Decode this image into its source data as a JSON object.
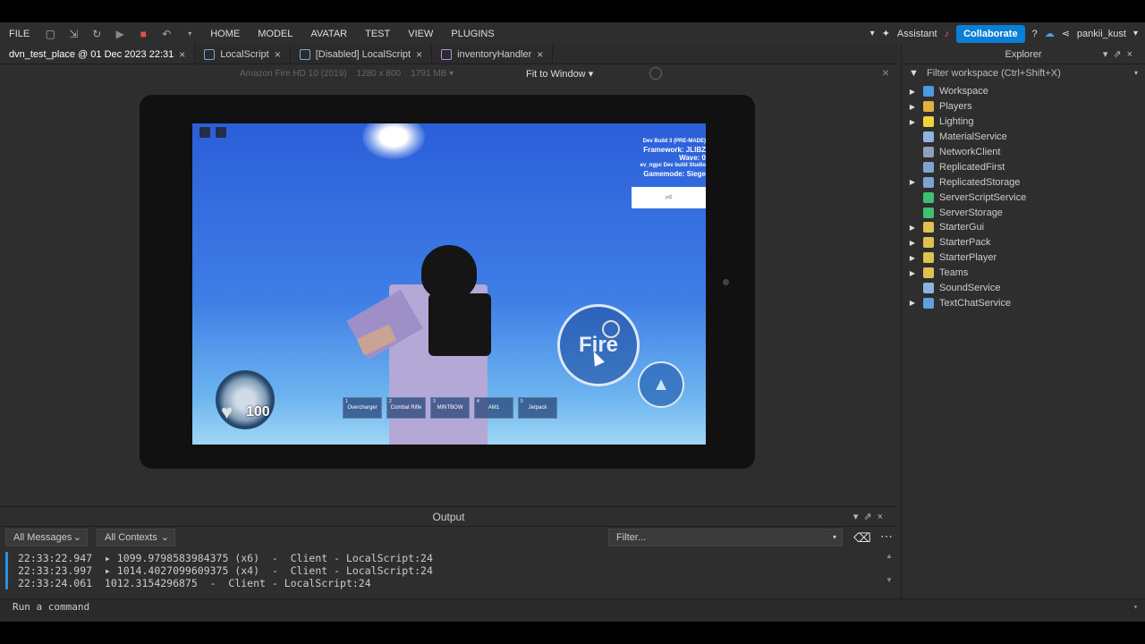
{
  "menu": {
    "items": [
      "FILE",
      "HOME",
      "MODEL",
      "AVATAR",
      "TEST",
      "VIEW",
      "PLUGINS"
    ],
    "assistant": "Assistant",
    "collaborate": "Collaborate",
    "username": "pankii_kust"
  },
  "tabs": [
    {
      "label": "dvn_test_place @ 01 Dec 2023 22:31"
    },
    {
      "label": "LocalScript"
    },
    {
      "label": "[Disabled] LocalScript"
    },
    {
      "label": "inventoryHandler"
    }
  ],
  "viewport_toolbar": {
    "device": "Amazon Fire HD 10 (2019)",
    "resolution": "1280 x 800",
    "memory": "1791 MB",
    "fit": "Fit to Window"
  },
  "game": {
    "info_lines": [
      "Dev Build 3 (PRE-MADE)",
      "Framework: JLIBZ",
      "Wave: 0",
      "ev_ngpc Dev build Studio",
      "Gamemode: Siege"
    ],
    "whitebox_text": "yd2",
    "health": "100",
    "fire_label": "Fire",
    "hotbar": [
      {
        "n": "1",
        "label": "Overcharger"
      },
      {
        "n": "2",
        "label": "Combat Rifle"
      },
      {
        "n": "3",
        "label": "MINTBOW"
      },
      {
        "n": "4",
        "label": "AM1"
      },
      {
        "n": "5",
        "label": "Jetpack"
      }
    ]
  },
  "explorer": {
    "title": "Explorer",
    "filter": "Filter workspace (Ctrl+Shift+X)",
    "items": [
      {
        "label": "Workspace",
        "expand": true,
        "color": "#4a9be0"
      },
      {
        "label": "Players",
        "expand": true,
        "color": "#e0b040"
      },
      {
        "label": "Lighting",
        "expand": true,
        "color": "#f2d23b"
      },
      {
        "label": "MaterialService",
        "expand": false,
        "color": "#8fb3e0"
      },
      {
        "label": "NetworkClient",
        "expand": false,
        "color": "#8fa0b8"
      },
      {
        "label": "ReplicatedFirst",
        "expand": false,
        "color": "#7fa3d0"
      },
      {
        "label": "ReplicatedStorage",
        "expand": true,
        "color": "#7fa3d0"
      },
      {
        "label": "ServerScriptService",
        "expand": false,
        "color": "#3fbf6f"
      },
      {
        "label": "ServerStorage",
        "expand": false,
        "color": "#3fbf6f"
      },
      {
        "label": "StarterGui",
        "expand": true,
        "color": "#e0c050"
      },
      {
        "label": "StarterPack",
        "expand": true,
        "color": "#e0c050"
      },
      {
        "label": "StarterPlayer",
        "expand": true,
        "color": "#e0c050"
      },
      {
        "label": "Teams",
        "expand": true,
        "color": "#e0c050"
      },
      {
        "label": "SoundService",
        "expand": false,
        "color": "#8fb3e0"
      },
      {
        "label": "TextChatService",
        "expand": true,
        "color": "#5fa0e0"
      }
    ]
  },
  "output": {
    "title": "Output",
    "messages_filter": "All Messages",
    "contexts_filter": "All Contexts",
    "filter_placeholder": "Filter...",
    "lines": [
      "22:33:22.947  ▸ 1099.9798583984375 (x6)  -  Client - LocalScript:24",
      "22:33:23.997  ▸ 1014.4027099609375 (x4)  -  Client - LocalScript:24",
      "22:33:24.061  1012.3154296875  -  Client - LocalScript:24"
    ]
  },
  "command": {
    "placeholder": "Run a command"
  }
}
